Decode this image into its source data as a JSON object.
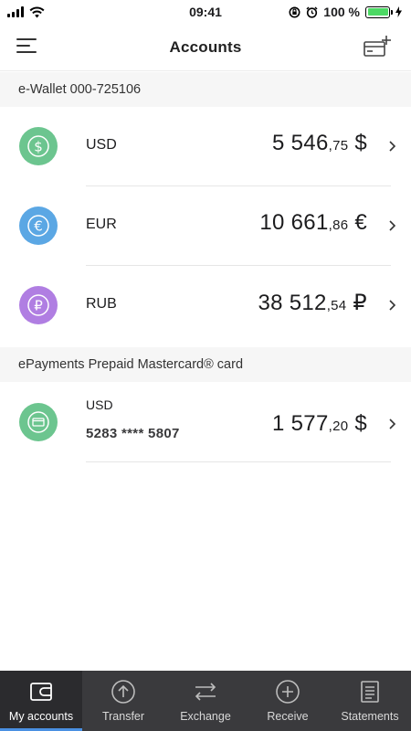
{
  "status_bar": {
    "time": "09:41",
    "battery": "100 %",
    "battery_level": 1.0
  },
  "header": {
    "title": "Accounts",
    "menu_icon": "hamburger-menu-icon",
    "add_icon": "add-card-icon"
  },
  "wallet": {
    "section_title": "e-Wallet 000-725106",
    "accounts": [
      {
        "currency": "USD",
        "amount_main": "5 546",
        "amount_cents": ",75",
        "symbol": "$",
        "icon": "dollar-icon",
        "color": "#6cc58f"
      },
      {
        "currency": "EUR",
        "amount_main": "10 661",
        "amount_cents": ",86",
        "symbol": "€",
        "icon": "euro-icon",
        "color": "#5ba7e4"
      },
      {
        "currency": "RUB",
        "amount_main": "38 512",
        "amount_cents": ",54",
        "symbol": "₽",
        "icon": "ruble-icon",
        "color": "#b07ee2"
      }
    ]
  },
  "card": {
    "section_title": "ePayments Prepaid Mastercard® card",
    "currency": "USD",
    "number": "5283 **** 5807",
    "amount_main": "1 577",
    "amount_cents": ",20",
    "symbol": "$",
    "icon": "credit-card-icon",
    "color": "#6cc58f"
  },
  "tabs": [
    {
      "label": "My accounts",
      "icon": "wallet-icon",
      "active": true
    },
    {
      "label": "Transfer",
      "icon": "arrow-up-circle-icon",
      "active": false
    },
    {
      "label": "Exchange",
      "icon": "exchange-arrows-icon",
      "active": false
    },
    {
      "label": "Receive",
      "icon": "plus-circle-icon",
      "active": false
    },
    {
      "label": "Statements",
      "icon": "document-list-icon",
      "active": false
    }
  ]
}
